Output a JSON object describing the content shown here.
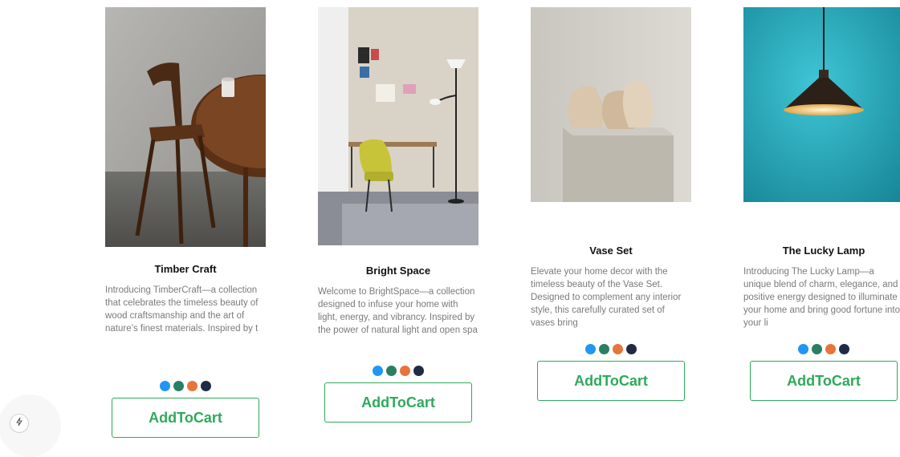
{
  "products": [
    {
      "title": "Timber Craft",
      "description": "Introducing TimberCraft—a collection that celebrates the timeless beauty of wood craftsmanship and the art of nature’s finest materials. Inspired by t",
      "button_label": "AddToCart"
    },
    {
      "title": "Bright Space",
      "description": "Welcome to BrightSpace—a collection designed to infuse your home with light, energy, and vibrancy. Inspired by the power of natural light and open spa",
      "button_label": "AddToCart"
    },
    {
      "title": "Vase Set",
      "description": "Elevate your home decor with the timeless beauty of the Vase Set. Designed to complement any interior style, this carefully curated set of vases bring",
      "button_label": "AddToCart"
    },
    {
      "title": "The Lucky Lamp",
      "description": "Introducing The Lucky Lamp—a unique blend of charm, elegance, and positive energy designed to illuminate your home and bring good fortune into your li",
      "button_label": "AddToCart"
    }
  ],
  "swatch_colors": [
    "#2196f3",
    "#2a7f62",
    "#e8743b",
    "#1f2a44"
  ],
  "accent_color": "#2eaa5b",
  "floating_icon": "bolt-icon"
}
